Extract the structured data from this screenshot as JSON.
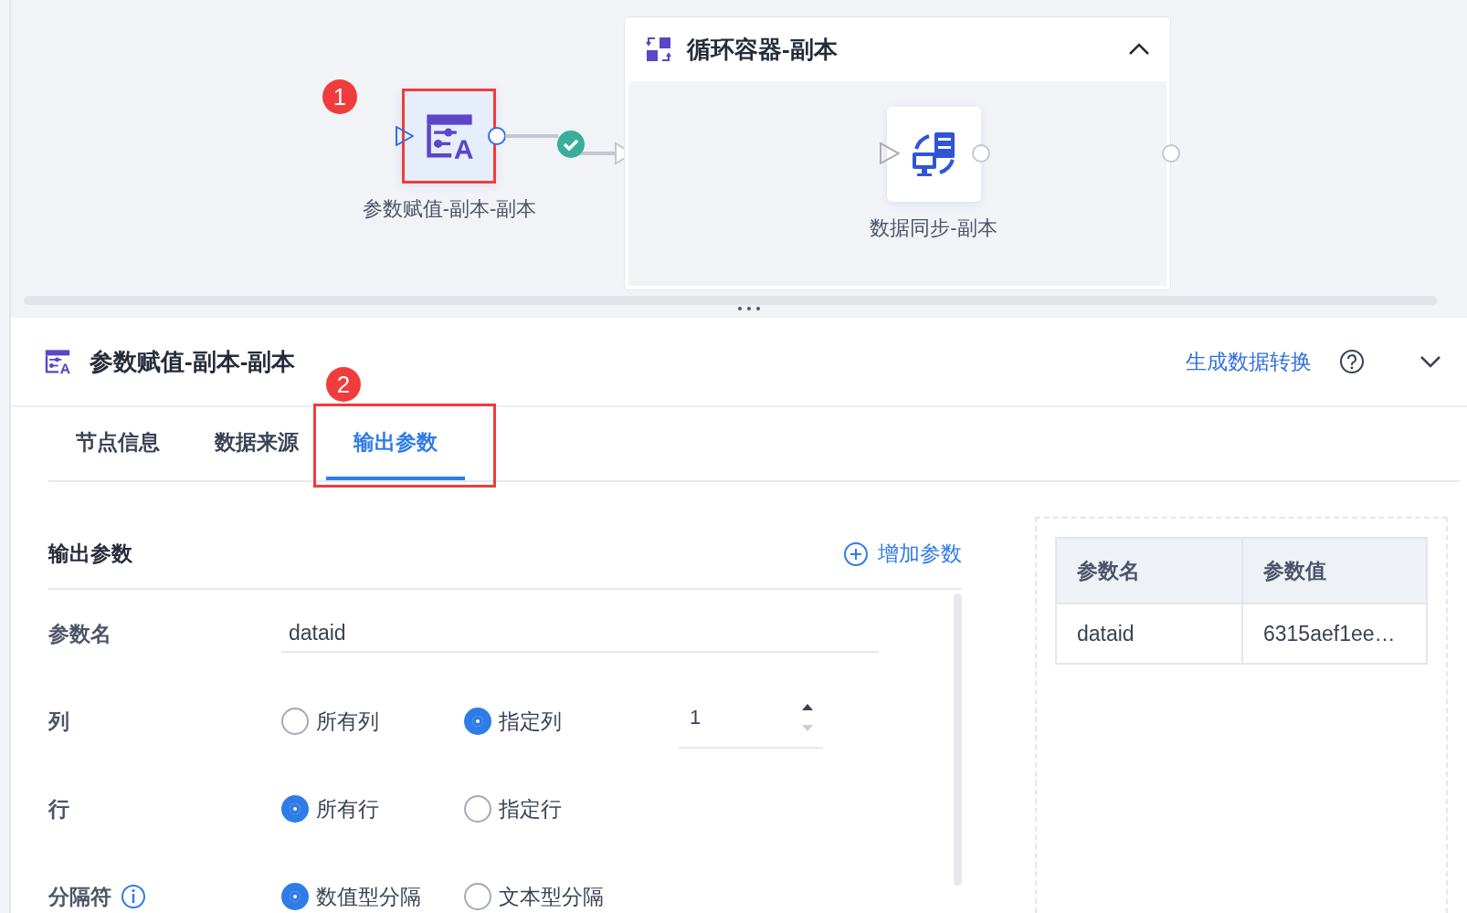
{
  "canvas": {
    "nodes": [
      {
        "label": "参数赋值-副本-副本",
        "selected": true,
        "badge": "1"
      }
    ],
    "container": {
      "title": "循环容器-副本",
      "expanded": true,
      "nodes": [
        {
          "label": "数据同步-副本",
          "selected": false
        }
      ]
    }
  },
  "panel": {
    "title": "参数赋值-副本-副本",
    "action_link": "生成数据转换"
  },
  "tabs": [
    {
      "label": "节点信息",
      "selected": false
    },
    {
      "label": "数据来源",
      "selected": false
    },
    {
      "label": "输出参数",
      "selected": true,
      "badge": "2"
    }
  ],
  "section": {
    "title": "输出参数",
    "add_button": "增加参数"
  },
  "form": [
    {
      "kind": "text",
      "label": "参数名",
      "value": "dataid"
    },
    {
      "kind": "radio",
      "label": "列",
      "options": [
        {
          "label": "所有列",
          "selected": false
        },
        {
          "label": "指定列",
          "selected": true
        }
      ],
      "number": "1"
    },
    {
      "kind": "radio",
      "label": "行",
      "options": [
        {
          "label": "所有行",
          "selected": true
        },
        {
          "label": "指定行",
          "selected": false
        }
      ]
    },
    {
      "kind": "radio",
      "label": "分隔符",
      "info": true,
      "options": [
        {
          "label": "数值型分隔",
          "selected": true
        },
        {
          "label": "文本型分隔",
          "selected": false
        }
      ]
    }
  ],
  "preview": {
    "columns": [
      "参数名",
      "参数值"
    ],
    "rows": [
      [
        "dataid",
        "6315aef1ee…"
      ]
    ]
  }
}
